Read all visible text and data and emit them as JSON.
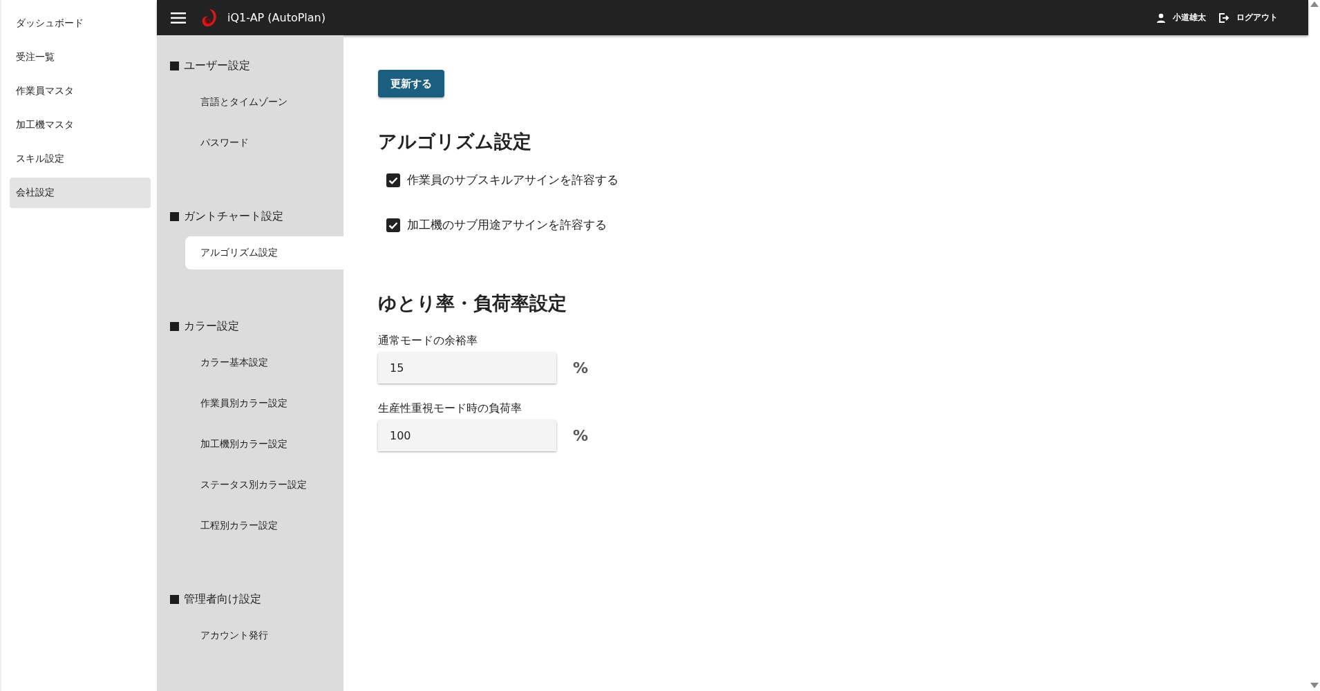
{
  "sidebar": {
    "items": [
      {
        "label": "ダッシュボード",
        "selected": false
      },
      {
        "label": "受注一覧",
        "selected": false
      },
      {
        "label": "作業員マスタ",
        "selected": false
      },
      {
        "label": "加工機マスタ",
        "selected": false
      },
      {
        "label": "スキル設定",
        "selected": false
      },
      {
        "label": "会社設定",
        "selected": true
      }
    ]
  },
  "header": {
    "title": "iQ1-AP (AutoPlan)",
    "user": "小道雄太",
    "logout": "ログアウト"
  },
  "settings_nav": {
    "sections": [
      {
        "title": "ユーザー設定",
        "items": [
          {
            "label": "言語とタイムゾーン",
            "selected": false
          },
          {
            "label": "パスワード",
            "selected": false
          }
        ]
      },
      {
        "title": "ガントチャート設定",
        "items": [
          {
            "label": "アルゴリズム設定",
            "selected": true
          }
        ]
      },
      {
        "title": "カラー設定",
        "items": [
          {
            "label": "カラー基本設定",
            "selected": false
          },
          {
            "label": "作業員別カラー設定",
            "selected": false
          },
          {
            "label": "加工機別カラー設定",
            "selected": false
          },
          {
            "label": "ステータス別カラー設定",
            "selected": false
          },
          {
            "label": "工程別カラー設定",
            "selected": false
          }
        ]
      },
      {
        "title": "管理者向け設定",
        "items": [
          {
            "label": "アカウント発行",
            "selected": false
          }
        ]
      }
    ]
  },
  "main": {
    "update_button": "更新する",
    "algorithm": {
      "heading": "アルゴリズム設定",
      "options": [
        {
          "label": "作業員のサブスキルアサインを許容する",
          "checked": true
        },
        {
          "label": "加工機のサブ用途アサインを許容する",
          "checked": true
        }
      ]
    },
    "rates": {
      "heading": "ゆとり率・負荷率設定",
      "fields": [
        {
          "label": "通常モードの余裕率",
          "value": "15",
          "unit": "%"
        },
        {
          "label": "生産性重視モード時の負荷率",
          "value": "100",
          "unit": "%"
        }
      ]
    }
  }
}
